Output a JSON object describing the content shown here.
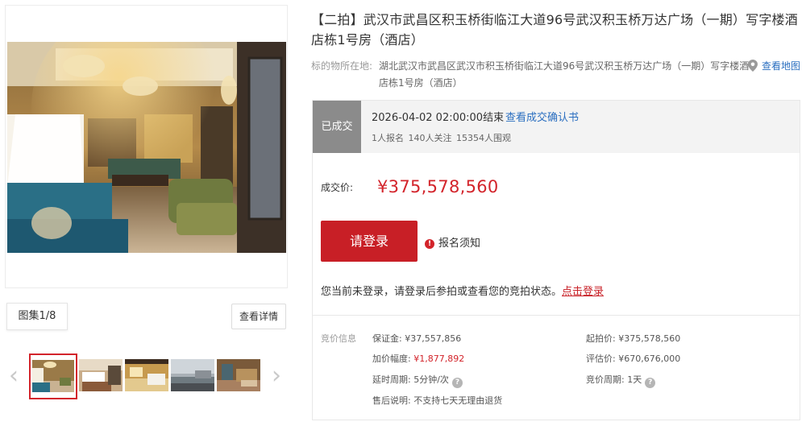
{
  "gallery": {
    "counter": "图集1/8",
    "detail_button": "查看详情",
    "prev_icon": "chevron-left-icon",
    "next_icon": "chevron-right-icon"
  },
  "listing": {
    "title": "【二拍】武汉市武昌区积玉桥街临江大道96号武汉积玉桥万达广场（一期）写字楼酒店栋1号房（酒店）",
    "location_label": "标的物所在地:",
    "location_text": "湖北武汉市武昌区武汉市积玉桥街临江大道96号武汉积玉桥万达广场（一期）写字楼酒店栋1号房（酒店）",
    "map_link": "查看地图"
  },
  "status": {
    "badge": "已成交",
    "end_time": "2026-04-02 02:00:00结束",
    "confirm_link": "查看成交确认书",
    "counts": "1人报名 140人关注 15354人围观"
  },
  "deal": {
    "price_label": "成交价:",
    "price_value": "¥375,578,560",
    "login_button": "请登录",
    "notice_link": "报名须知",
    "login_hint": "您当前未登录，请登录后参拍或查看您的竞拍状态。",
    "login_hint_link": "点击登录"
  },
  "bid_info": {
    "section_title": "竞价信息",
    "deposit_label": "保证金:",
    "deposit_value": "¥37,557,856",
    "increment_label": "加价幅度:",
    "increment_value": "¥1,877,892",
    "delay_label": "延时周期:",
    "delay_value": "5分钟/次",
    "after_sale_label": "售后说明:",
    "after_sale_value": "不支持七天无理由退货",
    "start_price_label": "起拍价:",
    "start_price_value": "¥375,578,560",
    "appraisal_label": "评估价:",
    "appraisal_value": "¥670,676,000",
    "cycle_label": "竞价周期:",
    "cycle_value": "1天"
  },
  "colors": {
    "accent_red": "#c81f26",
    "link_blue": "#2b6fc0",
    "badge_gray": "#8b8b8b"
  }
}
